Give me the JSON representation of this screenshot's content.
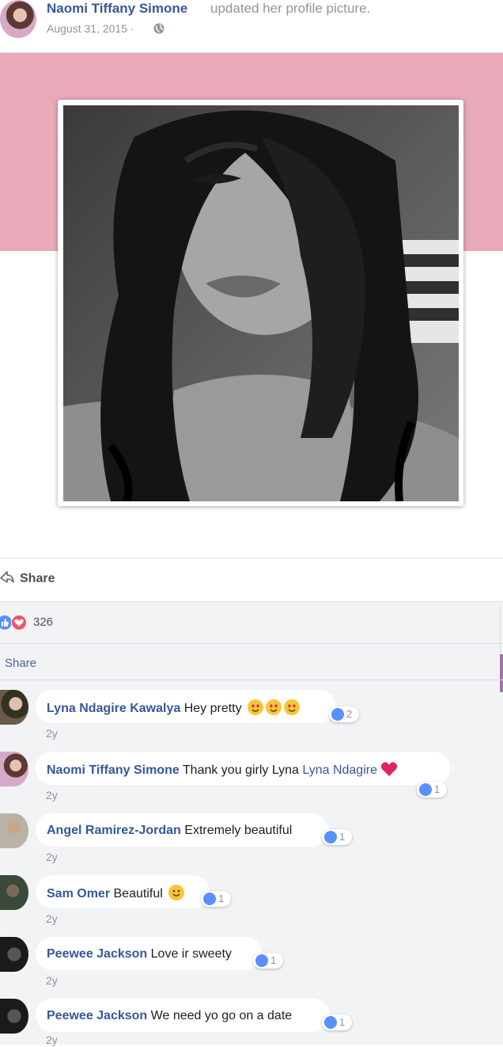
{
  "post": {
    "author": "Naomi Tiffany Simone",
    "action": "updated her profile picture.",
    "date": "August 31, 2015 ·",
    "privacy_icon": "globe-icon"
  },
  "actions": {
    "share_label": "Share"
  },
  "reactions": {
    "count": "326",
    "icons": [
      "like-icon",
      "love-icon"
    ]
  },
  "secondary_share": "Share",
  "colors": {
    "cover": "#e8aab8",
    "link": "#365899",
    "like": "#5890ff",
    "love": "#f25268"
  },
  "comments": [
    {
      "name": "Lyna Ndagire Kawalya",
      "text": "Hey pretty",
      "emojis": [
        "heart-eyes-icon",
        "heart-eyes-icon",
        "heart-eyes-icon"
      ],
      "likes": "2",
      "time": "2y"
    },
    {
      "name": "Naomi Tiffany Simone",
      "text": "Thank you girly Lyna",
      "mention": "Lyna Ndagire",
      "emojis": [
        "red-heart-icon"
      ],
      "likes": "1",
      "time": "2y"
    },
    {
      "name": "Angel Ramirez-Jordan",
      "text": "Extremely beautiful",
      "likes": "1",
      "time": "2y"
    },
    {
      "name": "Sam Omer",
      "text": "Beautiful",
      "emojis": [
        "smile-icon"
      ],
      "likes": "1",
      "time": "2y"
    },
    {
      "name": "Peewee Jackson",
      "text": "Love ir sweety",
      "likes": "1",
      "time": "2y"
    },
    {
      "name": "Peewee Jackson",
      "text": "We need yo go on a date",
      "likes": "1",
      "time": "2y"
    }
  ]
}
